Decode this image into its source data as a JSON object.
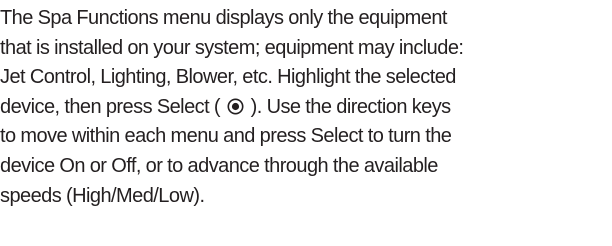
{
  "document": {
    "lines": [
      "The Spa Functions menu displays only the equipment",
      "that is installed on your system; equipment may include:",
      "Jet Control, Lighting, Blower, etc. Highlight the selected",
      "device, then press Select ( ",
      " ). Use the direction keys",
      "to move within each menu and press Select to turn the",
      "device On or Off, or to advance through the available",
      "speeds (High/Med/Low)."
    ],
    "icon": "select-button-icon",
    "text_color": "#231f20"
  }
}
